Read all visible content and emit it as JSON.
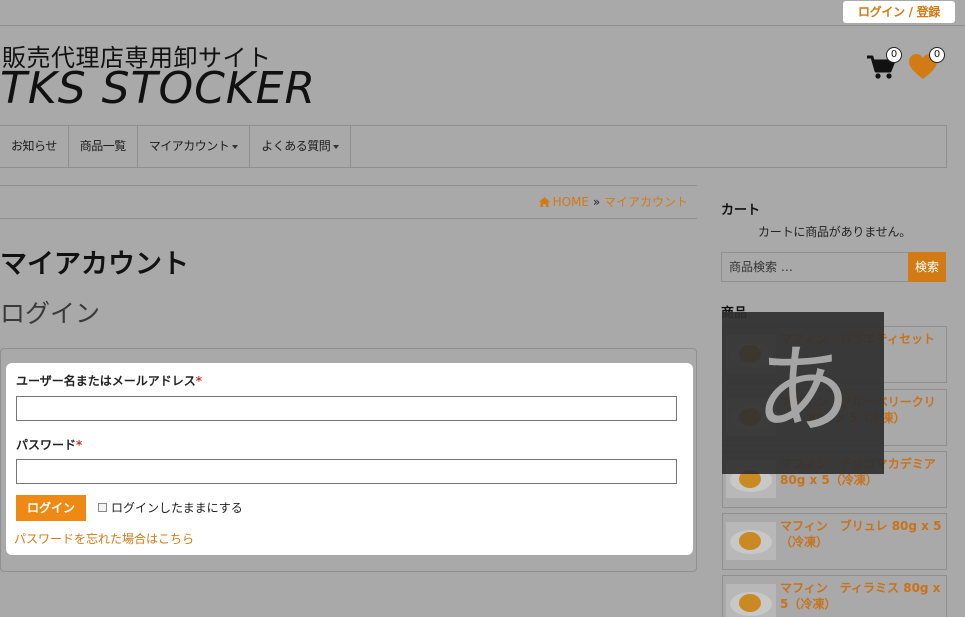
{
  "header": {
    "login_register": "ログイン / 登録",
    "site_subtitle": "販売代理店専用卸サイト",
    "site_title": "TKS STOCKER",
    "cart_count": "0",
    "wishlist_count": "0"
  },
  "nav": {
    "items": [
      {
        "label": "お知らせ"
      },
      {
        "label": "商品一覧"
      },
      {
        "label": "マイアカウント"
      },
      {
        "label": "よくある質問"
      }
    ]
  },
  "breadcrumb": {
    "home": "HOME",
    "separator": "»",
    "current": "マイアカウント"
  },
  "main": {
    "page_title": "マイアカウント",
    "section_title": "ログイン",
    "form": {
      "username_label": "ユーザー名またはメールアドレス",
      "password_label": "パスワード",
      "required_mark": "*",
      "submit_label": "ログイン",
      "remember_label": "ログインしたままにする",
      "lost_password": "パスワードを忘れた場合はこちら",
      "username_value": "",
      "password_value": ""
    }
  },
  "sidebar": {
    "cart_heading": "カート",
    "cart_empty": "カートに商品がありません。",
    "search_placeholder": "商品検索 …",
    "search_button": "検索",
    "products_heading": "商品",
    "products": [
      {
        "name": "マフィン　バラエティセット"
      },
      {
        "name": "マフィン　ブルーベリークリーム 80g x 5（冷凍）"
      },
      {
        "name": "マフィン　チョコマカデミア 80g x 5（冷凍）"
      },
      {
        "name": "マフィン　ブリュレ 80g x 5（冷凍）"
      },
      {
        "name": "マフィン　ティラミス 80g x 5（冷凍）"
      }
    ]
  },
  "ime_indicator": "あ",
  "colors": {
    "accent": "#d27a14",
    "button": "#ee8a14",
    "background": "#a9a9a9",
    "required": "#c0392b"
  }
}
